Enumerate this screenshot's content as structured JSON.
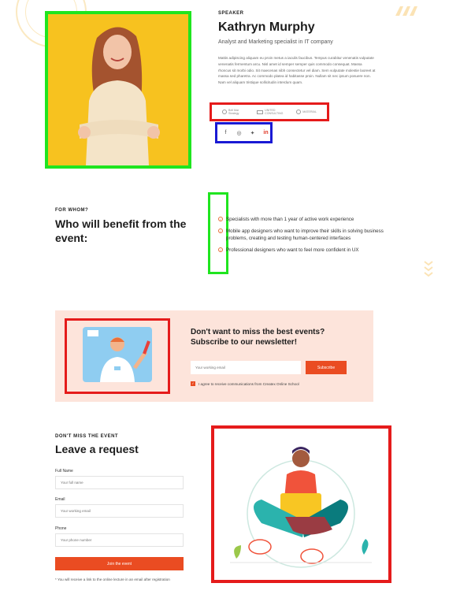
{
  "speaker": {
    "eyebrow": "SPEAKER",
    "name": "Kathryn Murphy",
    "role": "Analyst and Marketing specialist in IT company",
    "bio": "Mattis adipiscing aliquam eu proin metus a iaculis faucibus. Tempus curabitur venenatis vulputate venenatis fermentum arcu. Nisl amet id semper semper quis commodo consequat. Massa rhoncus sit morbi odio. Sit maecenas nibh consectetur vel diam. Sem vulputate molestie laoreet at massa sed pharetra. Ac commodo platea id habitasse proin. Nullam sit nec ipsum posuere non. Nam vel aliquam tristique sollicitudin interdum quam.",
    "partners": [
      {
        "name": "Bell Mar Strategy"
      },
      {
        "name": "UNITED CONSULTING"
      },
      {
        "name": "MATERIAL"
      }
    ],
    "socials": [
      {
        "icon": "facebook-icon",
        "glyph": "f"
      },
      {
        "icon": "instagram-icon",
        "glyph": "◎"
      },
      {
        "icon": "twitter-icon",
        "glyph": "✦"
      },
      {
        "icon": "linkedin-icon",
        "glyph": "in"
      }
    ]
  },
  "benefits": {
    "eyebrow": "FOR WHOM?",
    "title": "Who will benefit from the event:",
    "items": [
      "Specialists with more than 1 year of active work experience",
      "Mobile app designers who want to improve their skills in solving business problems, creating and testing human-centered interfaces",
      "Professional designers who want to feel more confident in UX"
    ]
  },
  "newsletter": {
    "title": "Don't want to miss the best events? Subscribe to our newsletter!",
    "email_placeholder": "Your working email",
    "subscribe_label": "Subscribe",
    "consent_label": "I agree to receive communications from Createx Online School"
  },
  "request": {
    "eyebrow": "DON'T MISS THE EVENT",
    "title": "Leave a request",
    "fields": [
      {
        "label": "Full Name",
        "placeholder": "Your full name"
      },
      {
        "label": "Email",
        "placeholder": "Your working email"
      },
      {
        "label": "Phone",
        "placeholder": "Your phone number"
      }
    ],
    "submit_label": "Join the event",
    "note": "* You will receive a link to the online lecture in an email after registration"
  },
  "colors": {
    "accent": "#ea4c22",
    "photo_bg": "#f7c21f",
    "newsletter_bg": "#fde4db"
  }
}
